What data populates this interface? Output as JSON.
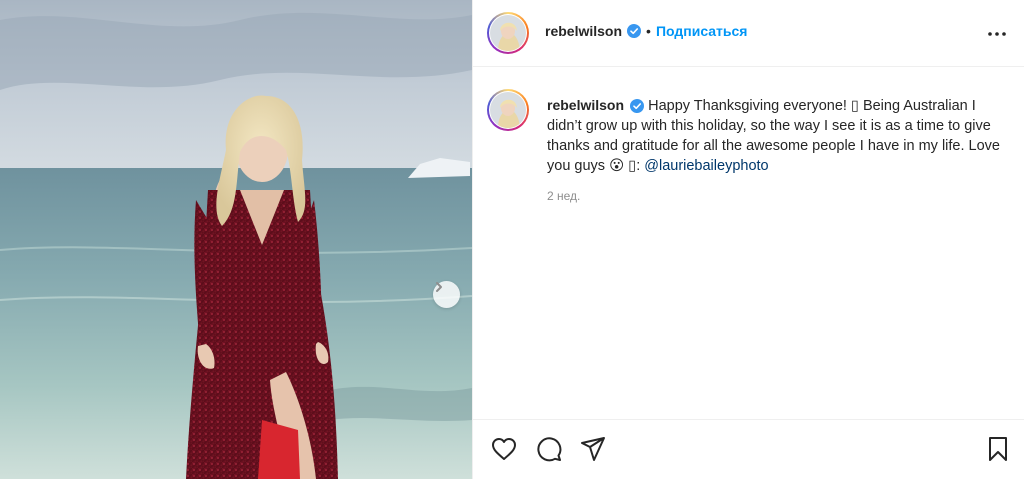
{
  "post": {
    "username": "rebelwilson",
    "follow_label": "Подписаться",
    "separator": "•",
    "caption_text": " Happy Thanksgiving everyone! ▯ Being Australian I didn’t grow up with this holiday, so the way I see it is as a time to give thanks and gratitude for all the awesome people I have in my life. Love you guys 😮 ▯: ",
    "mention": "@lauriebaileyphoto",
    "time_ago": "2 нед."
  },
  "icons": {
    "verified": "verified-badge-icon",
    "more": "more-options-icon",
    "like": "heart-icon",
    "comment": "comment-icon",
    "share": "send-icon",
    "save": "bookmark-icon",
    "next": "chevron-right-icon"
  },
  "colors": {
    "link": "#0095f6",
    "mention": "#00376b",
    "text": "#262626",
    "muted": "#8e8e8e",
    "dress": "#6e1020"
  }
}
